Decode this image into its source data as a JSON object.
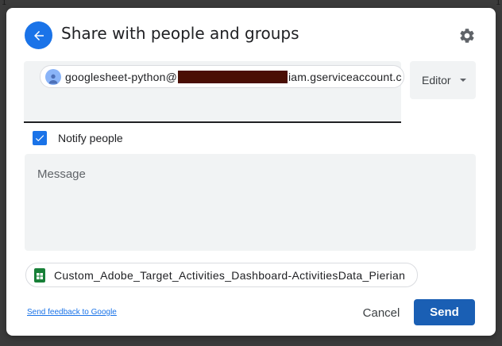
{
  "background": {
    "edge_marks": [
      "1",
      "1"
    ]
  },
  "dialog": {
    "title": "Share with people and groups",
    "back_icon": "arrow-back-icon",
    "settings_icon": "gear-icon"
  },
  "recipient": {
    "email_prefix": "googlesheet-python@",
    "email_suffix": "iam.gserviceaccount.c",
    "redacted": true
  },
  "role_select": {
    "value": "Editor"
  },
  "notify": {
    "label": "Notify people",
    "checked": true
  },
  "message": {
    "placeholder": "Message"
  },
  "file": {
    "name": "Custom_Adobe_Target_Activities_Dashboard-ActivitiesData_Pierian",
    "icon": "google-sheets-icon"
  },
  "footer": {
    "feedback_link": "Send feedback to Google",
    "cancel_label": "Cancel",
    "send_label": "Send"
  },
  "colors": {
    "accent": "#1a73e8",
    "send_button": "#1a5fb4",
    "field_bg": "#f1f3f4",
    "sheets_green": "#188038",
    "redaction": "#4a0f05"
  }
}
